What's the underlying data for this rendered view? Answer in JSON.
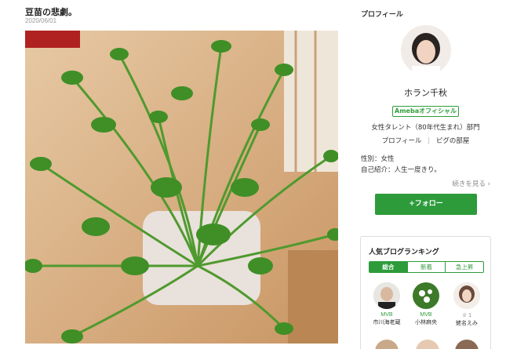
{
  "post": {
    "title": "豆苗の悲劇。",
    "date": "2020/06/01"
  },
  "profile": {
    "heading": "プロフィール",
    "name": "ホラン千秋",
    "badge": "Amebaオフィシャル",
    "description": "女性タレント（80年代生まれ）部門",
    "links": [
      "プロフィール",
      "ピグの部屋"
    ],
    "gender": "性別：女性",
    "intro": "自己紹介：人生一度きり。",
    "more": "続きを見る",
    "follow": "+フォロー"
  },
  "ranking": {
    "title": "人気ブログランキング",
    "tabs": [
      "総合",
      "新着",
      "急上昇"
    ],
    "active_tab": "総合",
    "bloggers": [
      {
        "level": "MVB",
        "name": "市川海老蔵"
      },
      {
        "level": "MVB",
        "name": "小林麻央"
      },
      {
        "level": "♕ 1",
        "name": "蛯名えみ"
      }
    ]
  },
  "colors": {
    "accent_green": "#2d9b3a"
  }
}
